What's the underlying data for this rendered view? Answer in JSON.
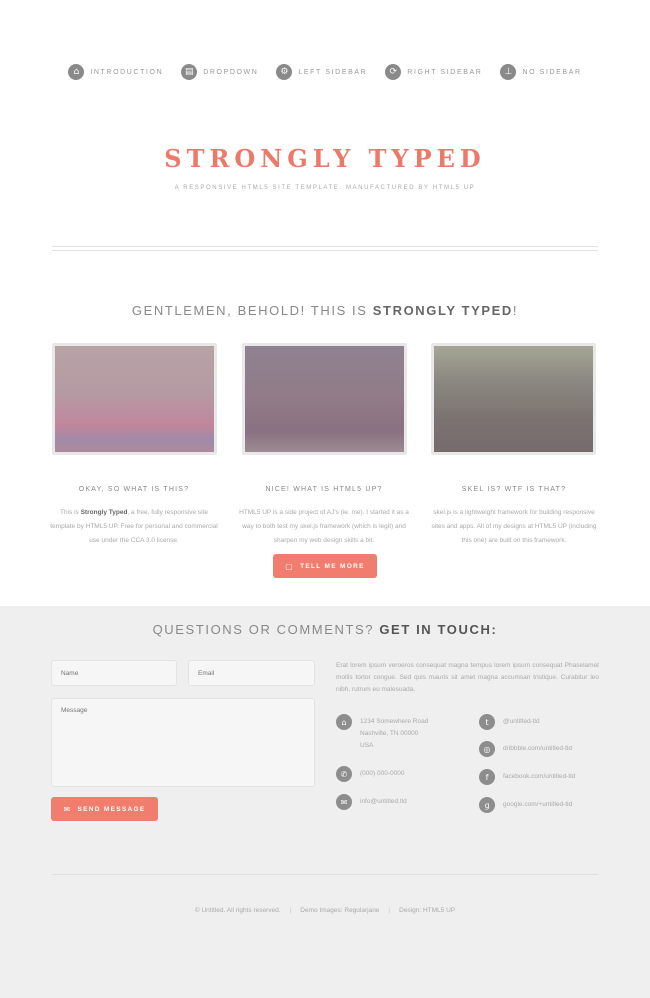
{
  "nav": [
    {
      "label": "INTRODUCTION",
      "icon": "home-icon",
      "glyph": "⌂"
    },
    {
      "label": "DROPDOWN",
      "icon": "chart-icon",
      "glyph": "▤"
    },
    {
      "label": "LEFT SIDEBAR",
      "icon": "gear-icon",
      "glyph": "⚙"
    },
    {
      "label": "RIGHT SIDEBAR",
      "icon": "retweet-icon",
      "glyph": "⟳"
    },
    {
      "label": "NO SIDEBAR",
      "icon": "sitemap-icon",
      "glyph": "⊥"
    }
  ],
  "header": {
    "logo": "STRONGLY TYPED",
    "tagline": "A RESPONSIVE HTML5 SITE TEMPLATE. MANUFACTURED BY HTML5 UP"
  },
  "banner": {
    "headline_prefix": "GENTLEMEN, BEHOLD! THIS IS ",
    "headline_strong": "STRONGLY TYPED",
    "headline_suffix": "!"
  },
  "features": [
    {
      "title": "OKAY, SO WHAT IS THIS?",
      "text_before": "This is ",
      "text_strong": "Strongly Typed",
      "text_after": ", a free, fully responsive site template by HTML5 UP. Free for personal and commercial use under the CCA 3.0 license.",
      "gradient": "linear-gradient(180deg,#b7a3a6 0%,#b59aa3 45%,#c0869c 75%,#9f8aa6 90%,#b08a9a 100%)"
    },
    {
      "title": "NICE! WHAT IS HTML5 UP?",
      "text_before": "HTML5 UP is a side project of AJ's (ie. me). I started it as a way to both test my skel.js framework (which is legit) and sharpen my web design skills a bit.",
      "text_strong": "",
      "text_after": "",
      "gradient": "linear-gradient(180deg,#8f8290 0%,#917b88 50%,#8a7080 80%,#9b8c93 100%)"
    },
    {
      "title": "SKEL IS? WTF IS THAT?",
      "text_before": "skel.js is a lightweight framework for building responsive sites and apps. All of my designs at HTML5 UP (including this one) are built on this framework.",
      "text_strong": "",
      "text_after": "",
      "gradient": "linear-gradient(180deg,#a5a697 0%,#8d8a82 30%,#7b7270 70%,#756b6d 100%)"
    }
  ],
  "buttons": {
    "tell_more": "TELL ME MORE",
    "send": "SEND MESSAGE"
  },
  "contact": {
    "title_prefix": "QUESTIONS OR COMMENTS? ",
    "title_strong": "GET IN TOUCH:",
    "name_placeholder": "Name",
    "email_placeholder": "Email",
    "message_placeholder": "Message",
    "blurb": "Erat lorem ipsum veroeros consequat magna tempus lorem ipsum consequat Phaselamet mollis tortor congue. Sed quis mauris sit amet magna accumsan tristique. Curabitur leo nibh, rutrum eu malesuada.",
    "address_lines": [
      "1234 Somewhere Road",
      "Nashville, TN 00000",
      "USA"
    ],
    "phone": "(000) 000-0000",
    "email": "info@untitled.tld",
    "twitter": "@untitled-tld",
    "dribbble": "dribbble.com/untitled-tld",
    "facebook": "facebook.com/untitled-tld",
    "google": "google.com/+untitled-tld"
  },
  "copyright": {
    "left": "© Untitled. All rights reserved.",
    "middle": "Demo Images: Regularjane",
    "right": "Design: HTML5 UP"
  },
  "colors": {
    "accent": "#f07d6d",
    "logo": "#ec7a6a",
    "footer_bg": "#efefef"
  }
}
